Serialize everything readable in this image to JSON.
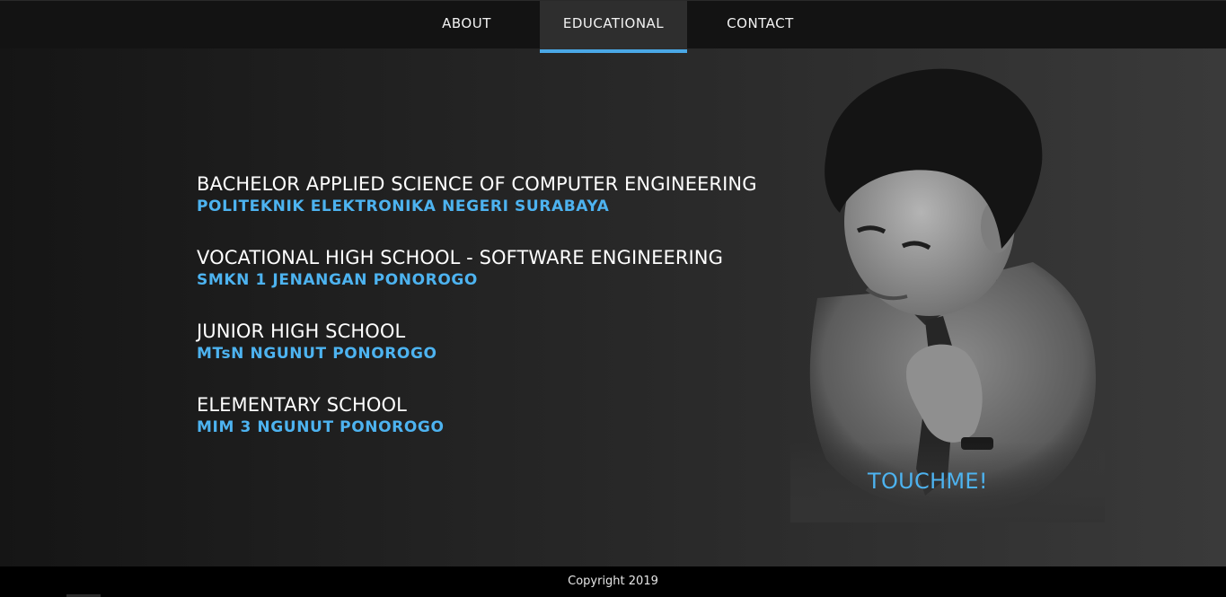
{
  "nav": {
    "items": [
      {
        "label": "ABOUT"
      },
      {
        "label": "EDUCATIONAL"
      },
      {
        "label": "CONTACT"
      }
    ],
    "active_index": 1
  },
  "education": [
    {
      "title": "BACHELOR APPLIED SCIENCE OF COMPUTER ENGINEERING",
      "school": "POLITEKNIK ELEKTRONIKA NEGERI SURABAYA"
    },
    {
      "title": "VOCATIONAL HIGH SCHOOL - SOFTWARE ENGINEERING",
      "school": "SMKN 1 JENANGAN PONOROGO"
    },
    {
      "title": "JUNIOR HIGH SCHOOL",
      "school": "MTsN NGUNUT PONOROGO"
    },
    {
      "title": "ELEMENTARY SCHOOL",
      "school": "MIM 3 NGUNUT PONOROGO"
    }
  ],
  "portrait": {
    "cta_label": "TOUCHME!"
  },
  "footer": {
    "copyright": "Copyright 2019"
  },
  "colors": {
    "accent": "#4db3f0",
    "nav_bg": "#131313",
    "footer_bg": "#000000"
  }
}
